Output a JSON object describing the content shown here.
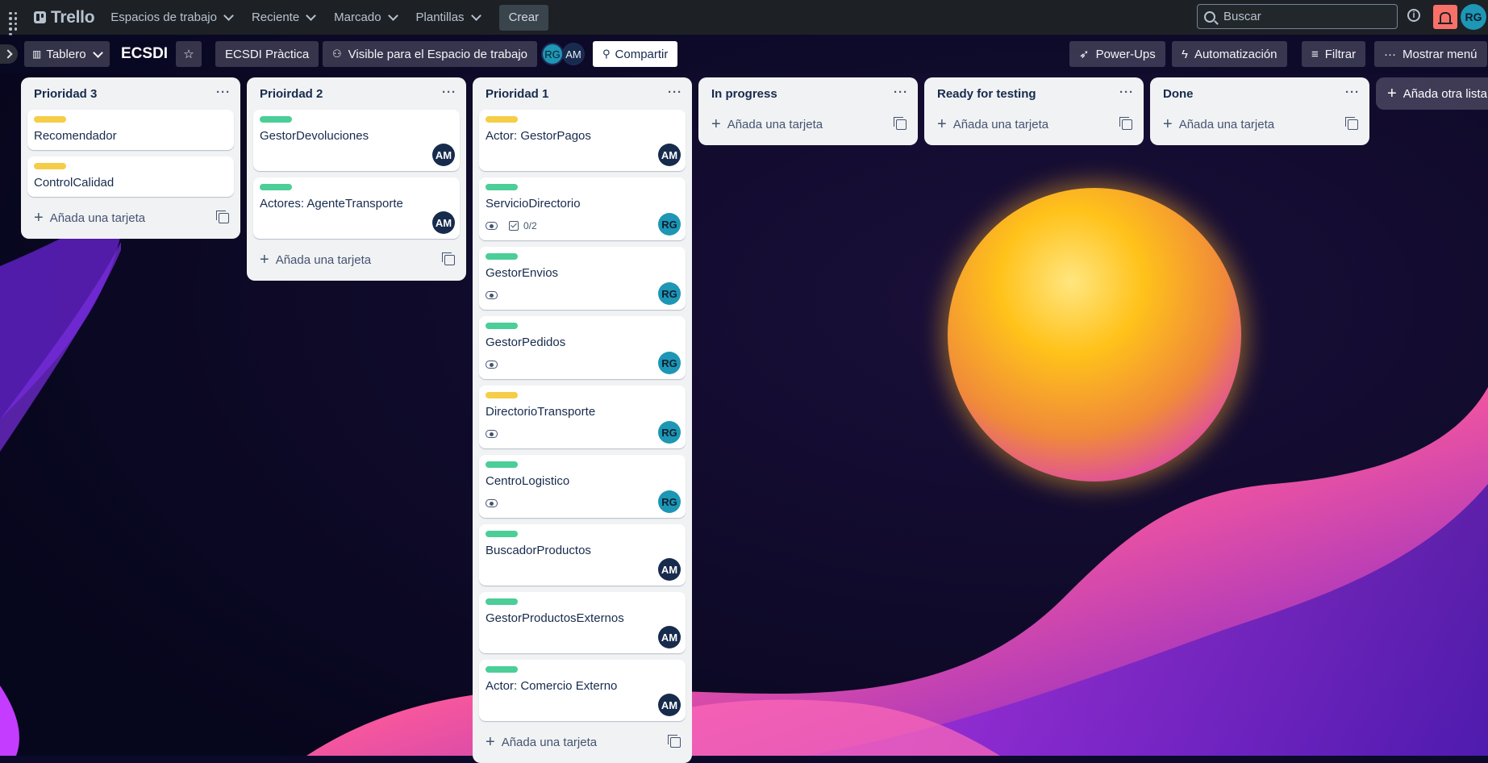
{
  "topnav": {
    "brand": "Trello",
    "workspaces": "Espacios de trabajo",
    "recent": "Reciente",
    "starred": "Marcado",
    "templates": "Plantillas",
    "create": "Crear",
    "search_placeholder": "Buscar",
    "avatar": "RG"
  },
  "board": {
    "view": "Tablero",
    "title": "ECSDI",
    "workspace": "ECSDI Pràctica",
    "visibility": "Visible para el Espacio de trabajo",
    "members": [
      "RG",
      "AM"
    ],
    "share": "Compartir",
    "powerups": "Power-Ups",
    "automation": "Automatización",
    "filter": "Filtrar",
    "show_menu": "Mostrar menú"
  },
  "colors": {
    "green": "#4bce97",
    "yellow": "#f5cd47",
    "am": "#172b4d",
    "rg": "#1e96b5"
  },
  "add_card": "Añada una tarjeta",
  "add_list": "Añada otra lista",
  "lists": [
    {
      "title": "Prioridad 3",
      "cards": [
        {
          "title": "Recomendador",
          "label": "yellow"
        },
        {
          "title": "ControlCalidad",
          "label": "yellow"
        }
      ]
    },
    {
      "title": "Prioirdad 2",
      "cards": [
        {
          "title": "GestorDevoluciones",
          "label": "green",
          "member": "AM"
        },
        {
          "title": "Actores: AgenteTransporte",
          "label": "green",
          "member": "AM"
        }
      ]
    },
    {
      "title": "Prioridad 1",
      "cards": [
        {
          "title": "Actor: GestorPagos",
          "label": "yellow",
          "member": "AM"
        },
        {
          "title": "ServicioDirectorio",
          "label": "green",
          "member": "RG",
          "watch": true,
          "checklist": "0/2"
        },
        {
          "title": "GestorEnvios",
          "label": "green",
          "member": "RG",
          "watch": true
        },
        {
          "title": "GestorPedidos",
          "label": "green",
          "member": "RG",
          "watch": true
        },
        {
          "title": "DirectorioTransporte",
          "label": "yellow",
          "member": "RG",
          "watch": true
        },
        {
          "title": "CentroLogistico",
          "label": "green",
          "member": "RG",
          "watch": true
        },
        {
          "title": "BuscadorProductos",
          "label": "green",
          "member": "AM"
        },
        {
          "title": "GestorProductosExternos",
          "label": "green",
          "member": "AM"
        },
        {
          "title": "Actor: Comercio Externo",
          "label": "green",
          "member": "AM"
        }
      ]
    },
    {
      "title": "In progress",
      "cards": []
    },
    {
      "title": "Ready for testing",
      "cards": []
    },
    {
      "title": "Done",
      "cards": []
    }
  ]
}
